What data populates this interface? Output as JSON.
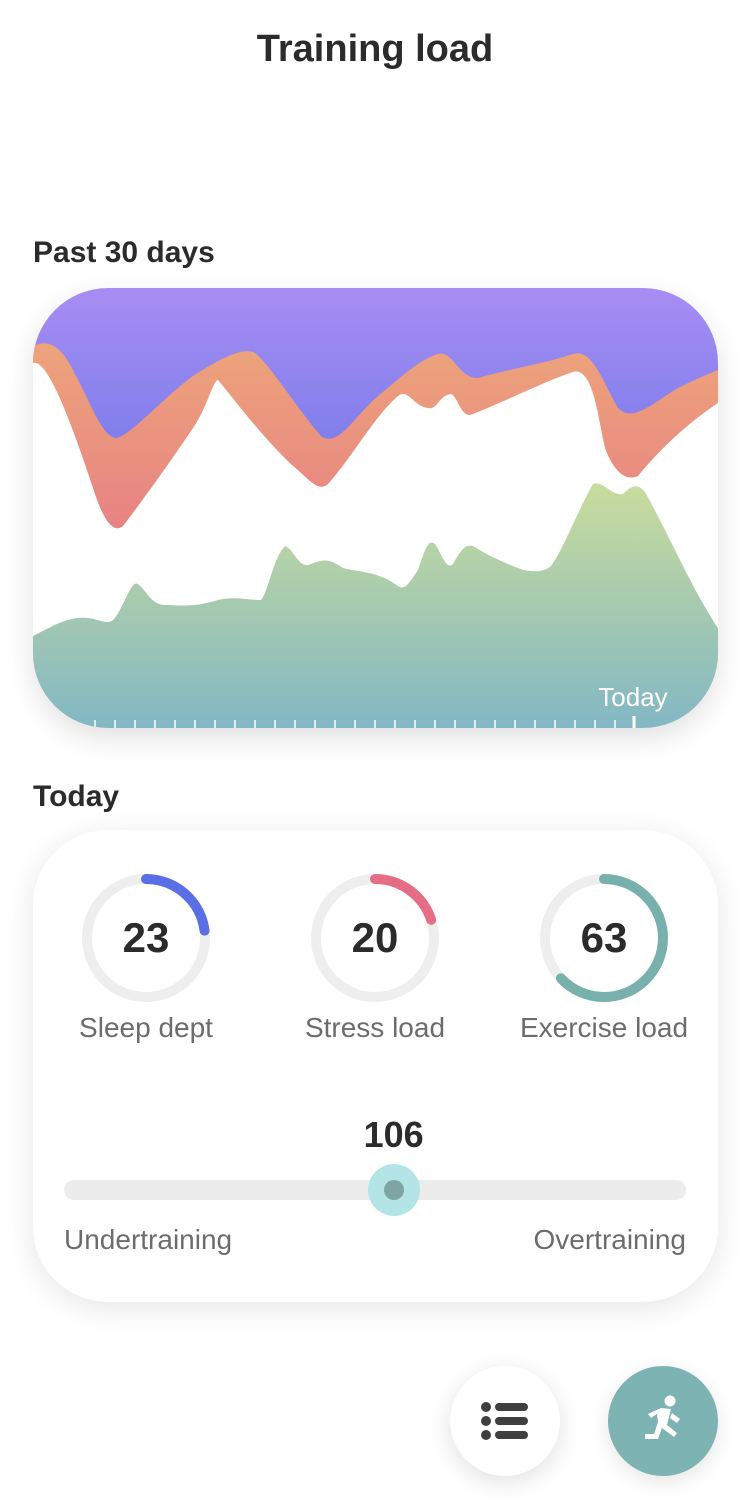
{
  "page": {
    "title": "Training load"
  },
  "past": {
    "label": "Past 30 days",
    "today_label": "Today"
  },
  "colors": {
    "top_band": "#a58bf2",
    "mid_band_top": "#eaa37d",
    "mid_band_bottom": "#e2608a",
    "bottom_area_top": "#c6dc9e",
    "bottom_area_bottom": "#84b8c2",
    "sleep": "#5a6ee6",
    "stress": "#e56e86",
    "exercise": "#78b0ae",
    "slider_knob": "#b3e4e6"
  },
  "today": {
    "label": "Today",
    "metrics": [
      {
        "value": "23",
        "label": "Sleep dept",
        "fraction": 0.23
      },
      {
        "value": "20",
        "label": "Stress load",
        "fraction": 0.2
      },
      {
        "value": "63",
        "label": "Exercise load",
        "fraction": 0.63
      }
    ],
    "total": "106",
    "balance_fraction": 0.53,
    "left_label": "Undertraining",
    "right_label": "Overtraining"
  },
  "actions": {
    "list_icon": "list-icon",
    "run_icon": "running-person-icon"
  }
}
